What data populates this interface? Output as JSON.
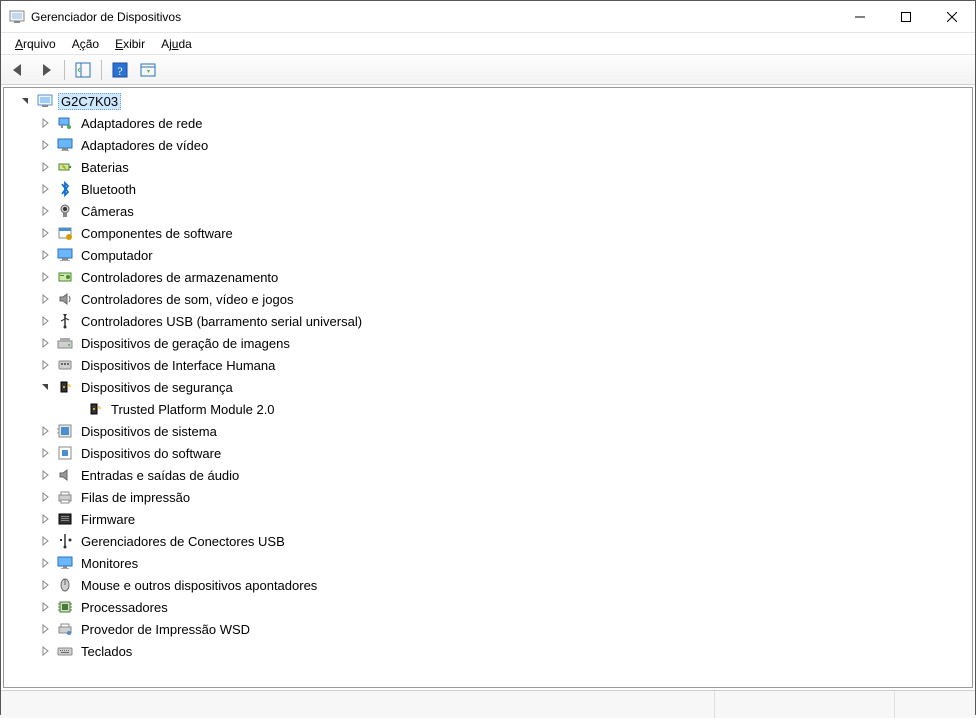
{
  "window": {
    "title": "Gerenciador de Dispositivos"
  },
  "menu": {
    "arquivo": "Arquivo",
    "acao": "Ação",
    "exibir": "Exibir",
    "ajuda": "Ajuda"
  },
  "tree": {
    "root": "G2C7K03",
    "items": [
      {
        "label": "Adaptadores de rede",
        "icon": "network"
      },
      {
        "label": "Adaptadores de vídeo",
        "icon": "display"
      },
      {
        "label": "Baterias",
        "icon": "battery"
      },
      {
        "label": "Bluetooth",
        "icon": "bluetooth"
      },
      {
        "label": "Câmeras",
        "icon": "camera"
      },
      {
        "label": "Componentes de software",
        "icon": "software"
      },
      {
        "label": "Computador",
        "icon": "computer"
      },
      {
        "label": "Controladores de armazenamento",
        "icon": "storage"
      },
      {
        "label": "Controladores de som, vídeo e jogos",
        "icon": "sound"
      },
      {
        "label": "Controladores USB (barramento serial universal)",
        "icon": "usb"
      },
      {
        "label": "Dispositivos de geração de imagens",
        "icon": "imaging"
      },
      {
        "label": "Dispositivos de Interface Humana",
        "icon": "hid"
      },
      {
        "label": "Dispositivos de segurança",
        "icon": "security",
        "expanded": true,
        "children": [
          {
            "label": "Trusted Platform Module 2.0",
            "icon": "tpm"
          }
        ]
      },
      {
        "label": "Dispositivos de sistema",
        "icon": "system"
      },
      {
        "label": "Dispositivos do software",
        "icon": "software2"
      },
      {
        "label": "Entradas e saídas de áudio",
        "icon": "audio"
      },
      {
        "label": "Filas de impressão",
        "icon": "printer"
      },
      {
        "label": "Firmware",
        "icon": "firmware"
      },
      {
        "label": "Gerenciadores de Conectores USB",
        "icon": "usbconn"
      },
      {
        "label": "Monitores",
        "icon": "monitor"
      },
      {
        "label": "Mouse e outros dispositivos apontadores",
        "icon": "mouse"
      },
      {
        "label": "Processadores",
        "icon": "cpu"
      },
      {
        "label": "Provedor de Impressão WSD",
        "icon": "wsd"
      },
      {
        "label": "Teclados",
        "icon": "keyboard"
      }
    ]
  }
}
